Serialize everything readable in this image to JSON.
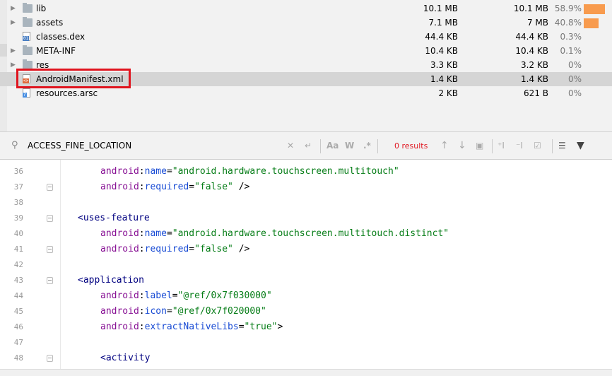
{
  "tree": {
    "rows": [
      {
        "expander": "▶",
        "icon": "folder-icon",
        "name": "lib",
        "size": "10.1 MB",
        "compressed": "10.1 MB",
        "percent": "58.9%",
        "bar": 0.589
      },
      {
        "expander": "▶",
        "icon": "folder-icon",
        "name": "assets",
        "size": "7.1 MB",
        "compressed": "7 MB",
        "percent": "40.8%",
        "bar": 0.408
      },
      {
        "expander": "",
        "icon": "dex-file-icon",
        "name": "classes.dex",
        "size": "44.4 KB",
        "compressed": "44.4 KB",
        "percent": "0.3%",
        "bar": 0
      },
      {
        "expander": "▶",
        "icon": "folder-icon",
        "name": "META-INF",
        "size": "10.4 KB",
        "compressed": "10.4 KB",
        "percent": "0.1%",
        "bar": 0
      },
      {
        "expander": "▶",
        "icon": "folder-icon",
        "name": "res",
        "size": "3.3 KB",
        "compressed": "3.2 KB",
        "percent": "0%",
        "bar": 0
      },
      {
        "expander": "",
        "icon": "xml-file-icon",
        "name": "AndroidManifest.xml",
        "size": "1.4 KB",
        "compressed": "1.4 KB",
        "percent": "0%",
        "bar": 0,
        "selected": true
      },
      {
        "expander": "",
        "icon": "arsc-file-icon",
        "name": "resources.arsc",
        "size": "2 KB",
        "compressed": "621 B",
        "percent": "0%",
        "bar": 0
      }
    ]
  },
  "search": {
    "value": "ACCESS_FINE_LOCATION",
    "results_label": "0 results",
    "match_case_label": "Aa",
    "words_label": "W",
    "regex_label": ".*"
  },
  "editor": {
    "lines": [
      {
        "n": "",
        "indent": 3,
        "fold": false,
        "tokens": [
          {
            "c": "t-tag",
            "t": "<uses-feature"
          }
        ]
      },
      {
        "n": "36",
        "indent": 4,
        "fold": false,
        "tokens": [
          {
            "c": "t-attr",
            "t": "android"
          },
          {
            "c": "t-punc",
            "t": ":"
          },
          {
            "c": "t-attrname",
            "t": "name"
          },
          {
            "c": "t-punc",
            "t": "="
          },
          {
            "c": "t-str",
            "t": "\"android.hardware.touchscreen.multitouch\""
          }
        ]
      },
      {
        "n": "37",
        "indent": 4,
        "fold": true,
        "tokens": [
          {
            "c": "t-attr",
            "t": "android"
          },
          {
            "c": "t-punc",
            "t": ":"
          },
          {
            "c": "t-attrname",
            "t": "required"
          },
          {
            "c": "t-punc",
            "t": "="
          },
          {
            "c": "t-str",
            "t": "\"false\""
          },
          {
            "c": "t-punc",
            "t": " />"
          }
        ]
      },
      {
        "n": "38",
        "indent": 0,
        "fold": false,
        "tokens": []
      },
      {
        "n": "39",
        "indent": 3,
        "fold": true,
        "tokens": [
          {
            "c": "t-tag",
            "t": "<uses-feature"
          }
        ]
      },
      {
        "n": "40",
        "indent": 4,
        "fold": false,
        "tokens": [
          {
            "c": "t-attr",
            "t": "android"
          },
          {
            "c": "t-punc",
            "t": ":"
          },
          {
            "c": "t-attrname",
            "t": "name"
          },
          {
            "c": "t-punc",
            "t": "="
          },
          {
            "c": "t-str",
            "t": "\"android.hardware.touchscreen.multitouch.distinct\""
          }
        ]
      },
      {
        "n": "41",
        "indent": 4,
        "fold": true,
        "tokens": [
          {
            "c": "t-attr",
            "t": "android"
          },
          {
            "c": "t-punc",
            "t": ":"
          },
          {
            "c": "t-attrname",
            "t": "required"
          },
          {
            "c": "t-punc",
            "t": "="
          },
          {
            "c": "t-str",
            "t": "\"false\""
          },
          {
            "c": "t-punc",
            "t": " />"
          }
        ]
      },
      {
        "n": "42",
        "indent": 0,
        "fold": false,
        "tokens": []
      },
      {
        "n": "43",
        "indent": 3,
        "fold": true,
        "tokens": [
          {
            "c": "t-tag",
            "t": "<application"
          }
        ]
      },
      {
        "n": "44",
        "indent": 4,
        "fold": false,
        "tokens": [
          {
            "c": "t-attr",
            "t": "android"
          },
          {
            "c": "t-punc",
            "t": ":"
          },
          {
            "c": "t-attrname",
            "t": "label"
          },
          {
            "c": "t-punc",
            "t": "="
          },
          {
            "c": "t-str",
            "t": "\"@ref/0x7f030000\""
          }
        ]
      },
      {
        "n": "45",
        "indent": 4,
        "fold": false,
        "tokens": [
          {
            "c": "t-attr",
            "t": "android"
          },
          {
            "c": "t-punc",
            "t": ":"
          },
          {
            "c": "t-attrname",
            "t": "icon"
          },
          {
            "c": "t-punc",
            "t": "="
          },
          {
            "c": "t-str",
            "t": "\"@ref/0x7f020000\""
          }
        ]
      },
      {
        "n": "46",
        "indent": 4,
        "fold": false,
        "tokens": [
          {
            "c": "t-attr",
            "t": "android"
          },
          {
            "c": "t-punc",
            "t": ":"
          },
          {
            "c": "t-attrname",
            "t": "extractNativeLibs"
          },
          {
            "c": "t-punc",
            "t": "="
          },
          {
            "c": "t-str",
            "t": "\"true\""
          },
          {
            "c": "t-punc",
            "t": ">"
          }
        ]
      },
      {
        "n": "47",
        "indent": 0,
        "fold": false,
        "tokens": []
      },
      {
        "n": "48",
        "indent": 4,
        "fold": true,
        "tokens": [
          {
            "c": "t-tag",
            "t": "<activity"
          }
        ]
      }
    ]
  },
  "colors": {
    "accent": "#e0141e",
    "bar": "#f89b4e",
    "selection": "#d5d5d5"
  }
}
